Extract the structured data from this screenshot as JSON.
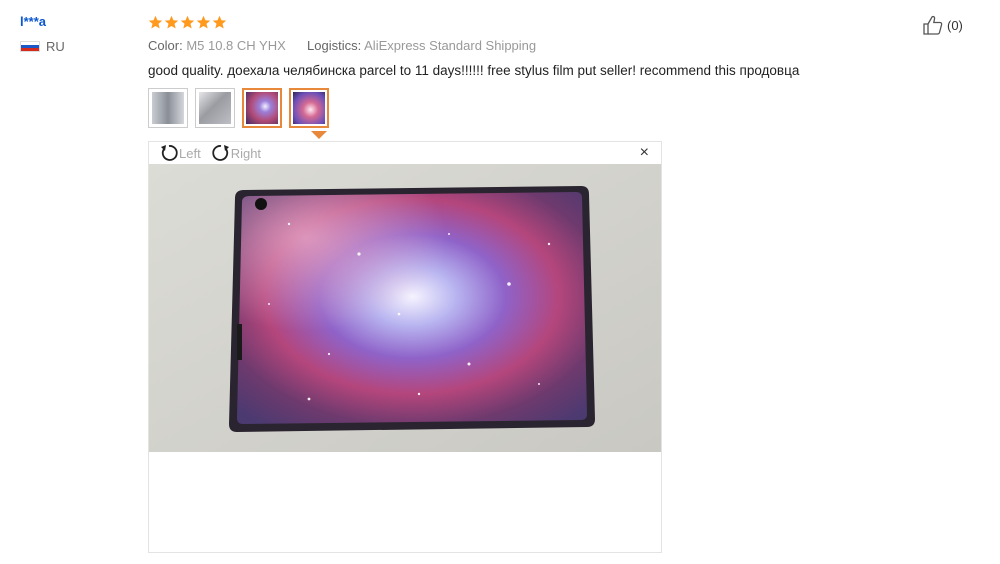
{
  "review": {
    "user": {
      "name": "l***a",
      "country": "RU"
    },
    "rating": {
      "stars": 5,
      "max": 5
    },
    "color_label": "Color:",
    "color_value": "M5 10.8 CH YHX",
    "logistics_label": "Logistics:",
    "logistics_value": "AliExpress Standard Shipping",
    "text": "good quality. доехала челябинска parcel to 11 days!!!!!! free stylus film put seller! recommend this продовца",
    "helpful_count": "(0)"
  },
  "thumbnails": [
    {
      "id": "photo-1",
      "active": false
    },
    {
      "id": "photo-2",
      "active": false
    },
    {
      "id": "photo-3",
      "active": true
    },
    {
      "id": "photo-4",
      "active": true
    }
  ],
  "viewer": {
    "rotate_left_label": "Left",
    "rotate_right_label": "Right",
    "close_symbol": "×"
  },
  "colors": {
    "star": "#ff9a1f",
    "accent": "#e7883b",
    "username": "#0b57d0"
  }
}
